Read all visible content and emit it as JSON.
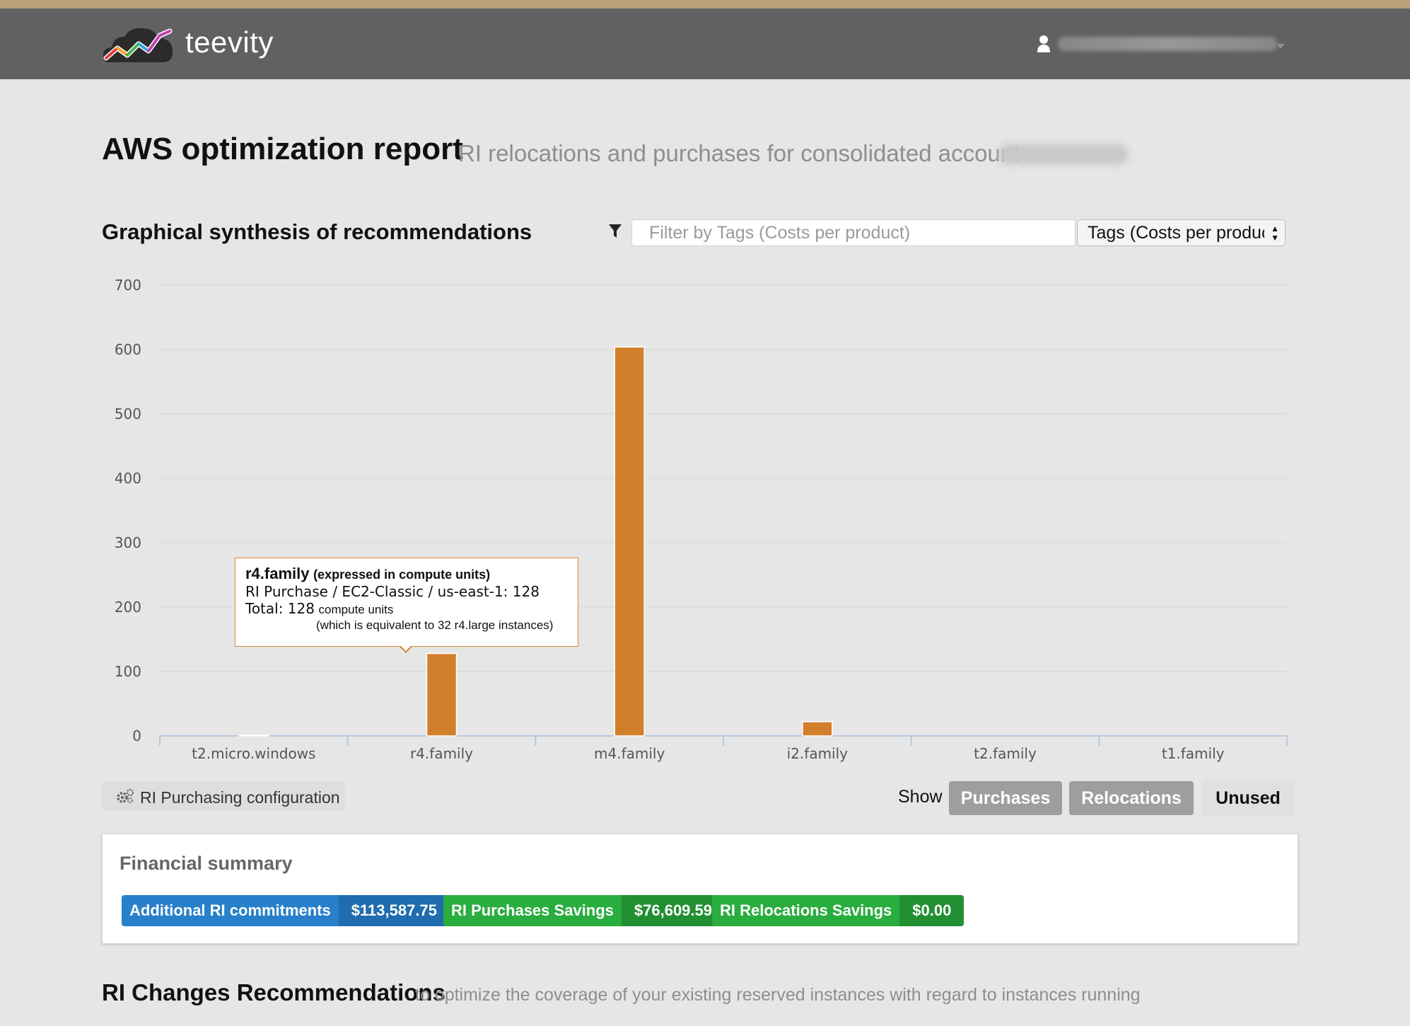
{
  "brand": {
    "name": "teevity"
  },
  "header": {
    "title": "AWS optimization report",
    "subtitle": "RI relocations and purchases for consolidated account"
  },
  "synthesis": {
    "title": "Graphical synthesis of recommendations",
    "filter_placeholder": "Filter by Tags (Costs per product)",
    "tags_select_value": "Tags (Costs per product)"
  },
  "chart_data": {
    "type": "bar",
    "categories": [
      "t2.micro.windows",
      "r4.family",
      "m4.family",
      "i2.family",
      "t2.family",
      "t1.family"
    ],
    "values": [
      1,
      128,
      604,
      22,
      0,
      0
    ],
    "ylim": [
      0,
      700
    ],
    "yticks": [
      "0",
      "100",
      "200",
      "300",
      "400",
      "500",
      "600",
      "700"
    ],
    "color": "#d27f2c",
    "grid": true
  },
  "tooltip": {
    "title": "r4.family",
    "title_note": "(expressed in compute units)",
    "line1": "RI Purchase / EC2-Classic / us-east-1: 128",
    "total_label": "Total: 128",
    "total_unit": "compute units",
    "note": "(which is equivalent to 32 r4.large instances)"
  },
  "controls": {
    "config_button": "RI Purchasing configuration",
    "show_label": "Show",
    "toggles": {
      "purchases": "Purchases",
      "relocations": "Relocations",
      "unused": "Unused"
    }
  },
  "financial_summary": {
    "title": "Financial summary",
    "items": [
      {
        "label": "Additional RI commitments",
        "value": "$113,587.75",
        "color": "#2780c9"
      },
      {
        "label": "RI Purchases Savings",
        "value": "$76,609.59",
        "color": "#29ad3f"
      },
      {
        "label": "RI Relocations Savings",
        "value": "$0.00",
        "color": "#29ad3f"
      }
    ]
  },
  "recommendations": {
    "title": "RI Changes Recommendations",
    "subtitle": "to optimize the coverage of your existing reserved instances with regard to instances running"
  },
  "icons": [
    "logo-icon",
    "user-icon",
    "caret-down-icon",
    "filter-icon",
    "gear-icon",
    "select-arrows-icon"
  ]
}
